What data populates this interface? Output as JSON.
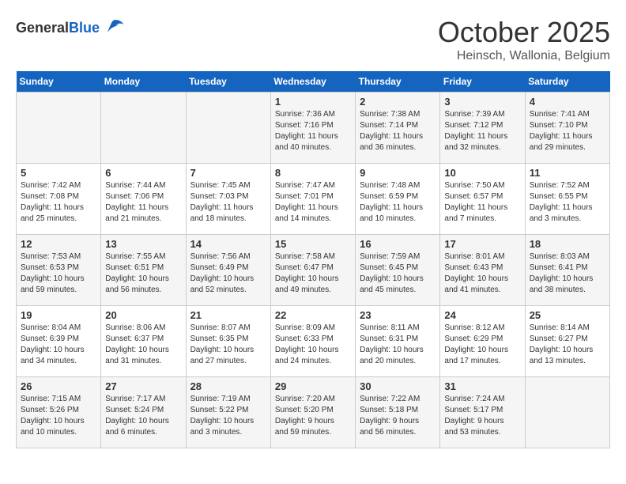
{
  "header": {
    "logo_general": "General",
    "logo_blue": "Blue",
    "month": "October 2025",
    "location": "Heinsch, Wallonia, Belgium"
  },
  "weekdays": [
    "Sunday",
    "Monday",
    "Tuesday",
    "Wednesday",
    "Thursday",
    "Friday",
    "Saturday"
  ],
  "weeks": [
    [
      {
        "day": "",
        "info": ""
      },
      {
        "day": "",
        "info": ""
      },
      {
        "day": "",
        "info": ""
      },
      {
        "day": "1",
        "info": "Sunrise: 7:36 AM\nSunset: 7:16 PM\nDaylight: 11 hours\nand 40 minutes."
      },
      {
        "day": "2",
        "info": "Sunrise: 7:38 AM\nSunset: 7:14 PM\nDaylight: 11 hours\nand 36 minutes."
      },
      {
        "day": "3",
        "info": "Sunrise: 7:39 AM\nSunset: 7:12 PM\nDaylight: 11 hours\nand 32 minutes."
      },
      {
        "day": "4",
        "info": "Sunrise: 7:41 AM\nSunset: 7:10 PM\nDaylight: 11 hours\nand 29 minutes."
      }
    ],
    [
      {
        "day": "5",
        "info": "Sunrise: 7:42 AM\nSunset: 7:08 PM\nDaylight: 11 hours\nand 25 minutes."
      },
      {
        "day": "6",
        "info": "Sunrise: 7:44 AM\nSunset: 7:06 PM\nDaylight: 11 hours\nand 21 minutes."
      },
      {
        "day": "7",
        "info": "Sunrise: 7:45 AM\nSunset: 7:03 PM\nDaylight: 11 hours\nand 18 minutes."
      },
      {
        "day": "8",
        "info": "Sunrise: 7:47 AM\nSunset: 7:01 PM\nDaylight: 11 hours\nand 14 minutes."
      },
      {
        "day": "9",
        "info": "Sunrise: 7:48 AM\nSunset: 6:59 PM\nDaylight: 11 hours\nand 10 minutes."
      },
      {
        "day": "10",
        "info": "Sunrise: 7:50 AM\nSunset: 6:57 PM\nDaylight: 11 hours\nand 7 minutes."
      },
      {
        "day": "11",
        "info": "Sunrise: 7:52 AM\nSunset: 6:55 PM\nDaylight: 11 hours\nand 3 minutes."
      }
    ],
    [
      {
        "day": "12",
        "info": "Sunrise: 7:53 AM\nSunset: 6:53 PM\nDaylight: 10 hours\nand 59 minutes."
      },
      {
        "day": "13",
        "info": "Sunrise: 7:55 AM\nSunset: 6:51 PM\nDaylight: 10 hours\nand 56 minutes."
      },
      {
        "day": "14",
        "info": "Sunrise: 7:56 AM\nSunset: 6:49 PM\nDaylight: 10 hours\nand 52 minutes."
      },
      {
        "day": "15",
        "info": "Sunrise: 7:58 AM\nSunset: 6:47 PM\nDaylight: 10 hours\nand 49 minutes."
      },
      {
        "day": "16",
        "info": "Sunrise: 7:59 AM\nSunset: 6:45 PM\nDaylight: 10 hours\nand 45 minutes."
      },
      {
        "day": "17",
        "info": "Sunrise: 8:01 AM\nSunset: 6:43 PM\nDaylight: 10 hours\nand 41 minutes."
      },
      {
        "day": "18",
        "info": "Sunrise: 8:03 AM\nSunset: 6:41 PM\nDaylight: 10 hours\nand 38 minutes."
      }
    ],
    [
      {
        "day": "19",
        "info": "Sunrise: 8:04 AM\nSunset: 6:39 PM\nDaylight: 10 hours\nand 34 minutes."
      },
      {
        "day": "20",
        "info": "Sunrise: 8:06 AM\nSunset: 6:37 PM\nDaylight: 10 hours\nand 31 minutes."
      },
      {
        "day": "21",
        "info": "Sunrise: 8:07 AM\nSunset: 6:35 PM\nDaylight: 10 hours\nand 27 minutes."
      },
      {
        "day": "22",
        "info": "Sunrise: 8:09 AM\nSunset: 6:33 PM\nDaylight: 10 hours\nand 24 minutes."
      },
      {
        "day": "23",
        "info": "Sunrise: 8:11 AM\nSunset: 6:31 PM\nDaylight: 10 hours\nand 20 minutes."
      },
      {
        "day": "24",
        "info": "Sunrise: 8:12 AM\nSunset: 6:29 PM\nDaylight: 10 hours\nand 17 minutes."
      },
      {
        "day": "25",
        "info": "Sunrise: 8:14 AM\nSunset: 6:27 PM\nDaylight: 10 hours\nand 13 minutes."
      }
    ],
    [
      {
        "day": "26",
        "info": "Sunrise: 7:15 AM\nSunset: 5:26 PM\nDaylight: 10 hours\nand 10 minutes."
      },
      {
        "day": "27",
        "info": "Sunrise: 7:17 AM\nSunset: 5:24 PM\nDaylight: 10 hours\nand 6 minutes."
      },
      {
        "day": "28",
        "info": "Sunrise: 7:19 AM\nSunset: 5:22 PM\nDaylight: 10 hours\nand 3 minutes."
      },
      {
        "day": "29",
        "info": "Sunrise: 7:20 AM\nSunset: 5:20 PM\nDaylight: 9 hours\nand 59 minutes."
      },
      {
        "day": "30",
        "info": "Sunrise: 7:22 AM\nSunset: 5:18 PM\nDaylight: 9 hours\nand 56 minutes."
      },
      {
        "day": "31",
        "info": "Sunrise: 7:24 AM\nSunset: 5:17 PM\nDaylight: 9 hours\nand 53 minutes."
      },
      {
        "day": "",
        "info": ""
      }
    ]
  ]
}
